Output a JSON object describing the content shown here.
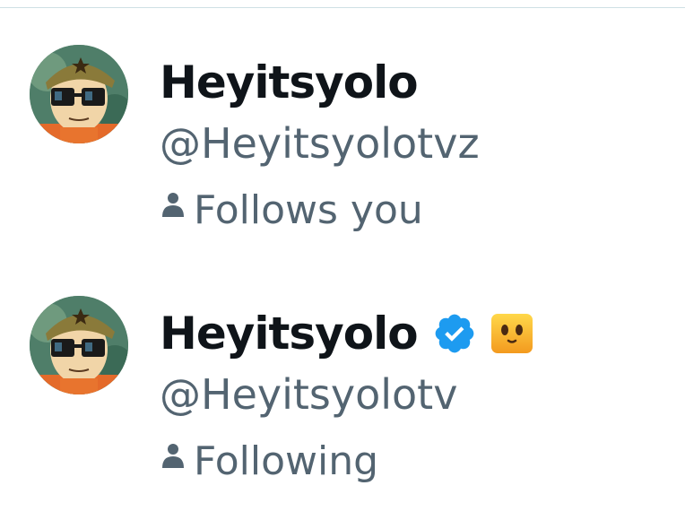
{
  "accounts": [
    {
      "display_name": "Heyitsyolo",
      "handle": "@Heyitsyolotvz",
      "status": "Follows you",
      "verified": false,
      "avatar_icon": "cartoon-soldier-sunglasses-avatar"
    },
    {
      "display_name": "Heyitsyolo",
      "handle": "@Heyitsyolotv",
      "status": "Following",
      "verified": true,
      "verified_icon": "blue-verified-check-icon",
      "emoji_icon": "smiling-face-emoji",
      "avatar_icon": "cartoon-soldier-sunglasses-avatar"
    }
  ],
  "colors": {
    "name": "#0f1419",
    "secondary": "#536471",
    "verified_blue": "#1d9bf0",
    "divider": "#cfe0e4"
  }
}
